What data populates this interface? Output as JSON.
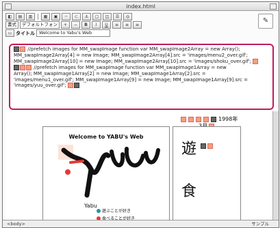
{
  "window": {
    "title": "index.html"
  },
  "toolbar": {
    "select_format": "書式",
    "select_font": "デフォルトフォン",
    "btn_b": "B",
    "btn_i": "I",
    "btn_u": "U",
    "title_label": "タイトル",
    "title_value": "Welcome to Yabu's Web"
  },
  "code": {
    "line1": "//prefetch images for MM_swapImage function var MM_swapImage2Array = new Array();",
    "line2": "MM_swapImage2Array[4] = new Image; MM_swapImage2Array[4].src = 'images/menu2_over.gif';",
    "line3": "MM_swapImage2Array[10] = new Image; MM_swapImage2Array[10].src = 'images/shoku_over.gif';",
    "line4": "//prefetch images for MM_swapImage function var MM_swapImage1Array = new",
    "line5": "Array(); MM_swapImage1Array[2] = new Image; MM_swapImage1Array[2].src =",
    "line6": "'images/menu1_over.gif'; MM_swapImage1Array[9] = new Image; MM_swapImage1Array[9].src =",
    "line7": "'images/yuu_over.gif';"
  },
  "page": {
    "welcome": "Welcome to YABU's Web",
    "logo": "Yabu",
    "year": "1998年",
    "month": "3月",
    "menu1": "遊ぶことが好き",
    "menu2": "食べることが好き",
    "kanji1": "遊",
    "kanji2": "食"
  },
  "status": {
    "left": "<body>",
    "right": "サンプル"
  },
  "colors": {
    "highlight": "#c2185b",
    "accent_orange": "#f3a07a"
  }
}
